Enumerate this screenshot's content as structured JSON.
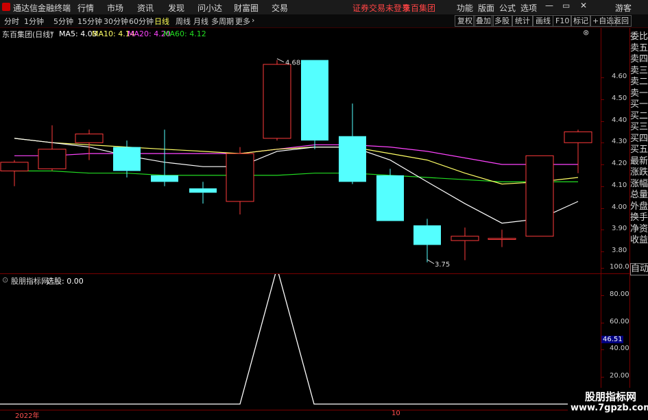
{
  "titlebar": {
    "app_title": "通达信金融终端",
    "menu": [
      "行情",
      "市场",
      "资讯",
      "发现",
      "问小达",
      "财富圈",
      "交易"
    ],
    "notice": "证券交易未登录",
    "stock_name": "东百集团",
    "right_menu": [
      "功能",
      "版面",
      "公式",
      "选项"
    ],
    "guest": "游客"
  },
  "toolbar": {
    "periods": [
      "分时",
      "1分钟",
      "5分钟",
      "15分钟",
      "30分钟",
      "60分钟",
      "日线",
      "周线",
      "月线",
      "多周期",
      "更多"
    ],
    "active_period": "日线",
    "buttons": [
      "复权",
      "叠加",
      "多股",
      "统计",
      "画线",
      "F10",
      "标记",
      "+自选",
      "返回"
    ]
  },
  "legend": {
    "title": "东百集团(日线)",
    "ma5": "MA5: 4.03",
    "ma10": "MA10: 4.14",
    "ma20": "MA20: 4.20",
    "ma60": "MA60: 4.12",
    "colors": {
      "ma5": "#ffffff",
      "ma10": "#ffff66",
      "ma20": "#ff44ff",
      "ma60": "#22dd22"
    }
  },
  "price_axis": [
    "4.60",
    "4.50",
    "4.40",
    "4.30",
    "4.20",
    "4.10",
    "4.00",
    "3.90",
    "3.80"
  ],
  "price_labels": {
    "high": "4.68",
    "low": "3.75"
  },
  "side_panel": [
    "委比",
    "卖五",
    "卖四",
    "卖三",
    "卖二",
    "卖一",
    "买一",
    "买二",
    "买三",
    "买四",
    "买五",
    "最新",
    "涨跌",
    "涨幅",
    "总量",
    "外盘",
    "换手",
    "净资",
    "收益"
  ],
  "auto_button": "自动",
  "indicator": {
    "name": "股朋指标网",
    "select_label": "选股: 0.00",
    "axis": [
      "100.0",
      "80.00",
      "60.00",
      "40.00",
      "20.00"
    ],
    "current_value": "46.51"
  },
  "date_axis": {
    "year": "2022年",
    "month": "10"
  },
  "watermark": {
    "name": "股朋指标网",
    "url": "www.7gpzb.com"
  },
  "chart_data": {
    "type": "candlestick",
    "candles": [
      {
        "open": 4.17,
        "close": 4.21,
        "high": 4.22,
        "low": 4.1
      },
      {
        "open": 4.18,
        "close": 4.27,
        "high": 4.38,
        "low": 4.17
      },
      {
        "open": 4.3,
        "close": 4.34,
        "high": 4.36,
        "low": 4.22
      },
      {
        "open": 4.28,
        "close": 4.17,
        "high": 4.31,
        "low": 4.14
      },
      {
        "open": 4.15,
        "close": 4.12,
        "high": 4.36,
        "low": 4.1
      },
      {
        "open": 4.09,
        "close": 4.07,
        "high": 4.12,
        "low": 4.02
      },
      {
        "open": 4.03,
        "close": 4.25,
        "high": 4.28,
        "low": 3.97
      },
      {
        "open": 4.32,
        "close": 4.66,
        "high": 4.68,
        "low": 4.31
      },
      {
        "open": 4.68,
        "close": 4.31,
        "high": 4.68,
        "low": 4.27
      },
      {
        "open": 4.33,
        "close": 4.12,
        "high": 4.48,
        "low": 4.11
      },
      {
        "open": 4.15,
        "close": 3.94,
        "high": 4.18,
        "low": 3.94
      },
      {
        "open": 3.92,
        "close": 3.83,
        "high": 3.95,
        "low": 3.75
      },
      {
        "open": 3.85,
        "close": 3.87,
        "high": 3.91,
        "low": 3.76
      },
      {
        "open": 3.86,
        "close": 3.86,
        "high": 3.9,
        "low": 3.82
      },
      {
        "open": 3.87,
        "close": 4.24,
        "high": 4.24,
        "low": 3.87
      },
      {
        "open": 4.3,
        "close": 4.35,
        "high": 4.36,
        "low": 4.16
      }
    ],
    "ma5": [
      4.32,
      4.3,
      4.28,
      4.24,
      4.21,
      4.19,
      4.19,
      4.26,
      4.28,
      4.28,
      4.22,
      4.12,
      4.02,
      3.93,
      3.95,
      4.03
    ],
    "ma10": [
      4.32,
      4.3,
      4.29,
      4.28,
      4.27,
      4.26,
      4.25,
      4.27,
      4.28,
      4.28,
      4.25,
      4.22,
      4.16,
      4.11,
      4.12,
      4.14
    ],
    "ma20": [
      4.24,
      4.24,
      4.25,
      4.25,
      4.25,
      4.25,
      4.25,
      4.27,
      4.29,
      4.29,
      4.28,
      4.26,
      4.23,
      4.2,
      4.2,
      4.2
    ],
    "ma60": [
      4.17,
      4.17,
      4.16,
      4.16,
      4.15,
      4.15,
      4.15,
      4.15,
      4.16,
      4.16,
      4.15,
      4.14,
      4.13,
      4.12,
      4.12,
      4.12
    ],
    "ylim": [
      3.73,
      4.72
    ],
    "indicator_values": [
      0,
      0,
      0,
      0,
      0,
      0,
      0,
      0,
      0,
      0,
      0,
      0,
      0,
      0,
      0,
      0
    ],
    "indicator_spike": {
      "x": 404,
      "value": 100
    },
    "indicator_ylim": [
      0,
      105
    ]
  }
}
